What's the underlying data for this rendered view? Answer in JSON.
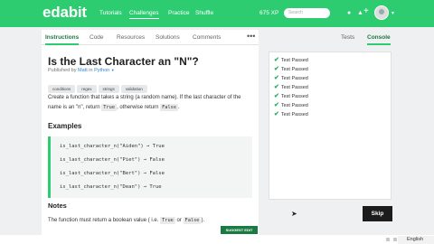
{
  "header": {
    "logo": "edabit",
    "nav": [
      {
        "label": "Tutorials",
        "active": false
      },
      {
        "label": "Challenges",
        "active": true
      },
      {
        "label": "Practice",
        "active": false
      },
      {
        "label": "Shuffle",
        "active": false
      }
    ],
    "xp": "675 XP",
    "search_placeholder": "Search",
    "icons": [
      "lock-icon",
      "bell-icon",
      "plus-icon",
      "avatar"
    ]
  },
  "left_tabs": [
    "Instructions",
    "Code",
    "Resources",
    "Solutions",
    "Comments"
  ],
  "more_label": "•••",
  "challenge": {
    "title": "Is the Last Character an \"N\"?",
    "published_by": "Published by",
    "author": "Matt",
    "in": "in",
    "language": "Python",
    "tags": [
      "conditions",
      "regex",
      "strings",
      "validation"
    ],
    "desc_part1": "Create a function that takes a string (a random name). If the last character of the name is an \"n\", return",
    "true_code": "True",
    "desc_part2": ", otherwise return",
    "false_code": "False",
    "desc_end": ".",
    "examples_heading": "Examples",
    "examples": [
      "is_last_character_n(\"Aiden\") → True",
      "is_last_character_n(\"Piet\") → False",
      "is_last_character_n(\"Bert\") → False",
      "is_last_character_n(\"Dean\") → True"
    ],
    "notes_heading": "Notes",
    "notes_part1": "The function must return a boolean value ( i.e.",
    "notes_true": "True",
    "notes_or": "or",
    "notes_false": "False",
    "notes_end": ").",
    "suggest_label": "SUGGEST EDIT"
  },
  "right_tabs": [
    "Tests",
    "Console"
  ],
  "tests": [
    "Test Passed",
    "Test Passed",
    "Test Passed",
    "Test Passed",
    "Test Passed",
    "Test Passed",
    "Test Passed"
  ],
  "skip_label": "Skip",
  "language_select": "English",
  "colors": {
    "brand": "#2ecc71",
    "dark_green": "#1a7a43",
    "pass": "#27ae60"
  }
}
